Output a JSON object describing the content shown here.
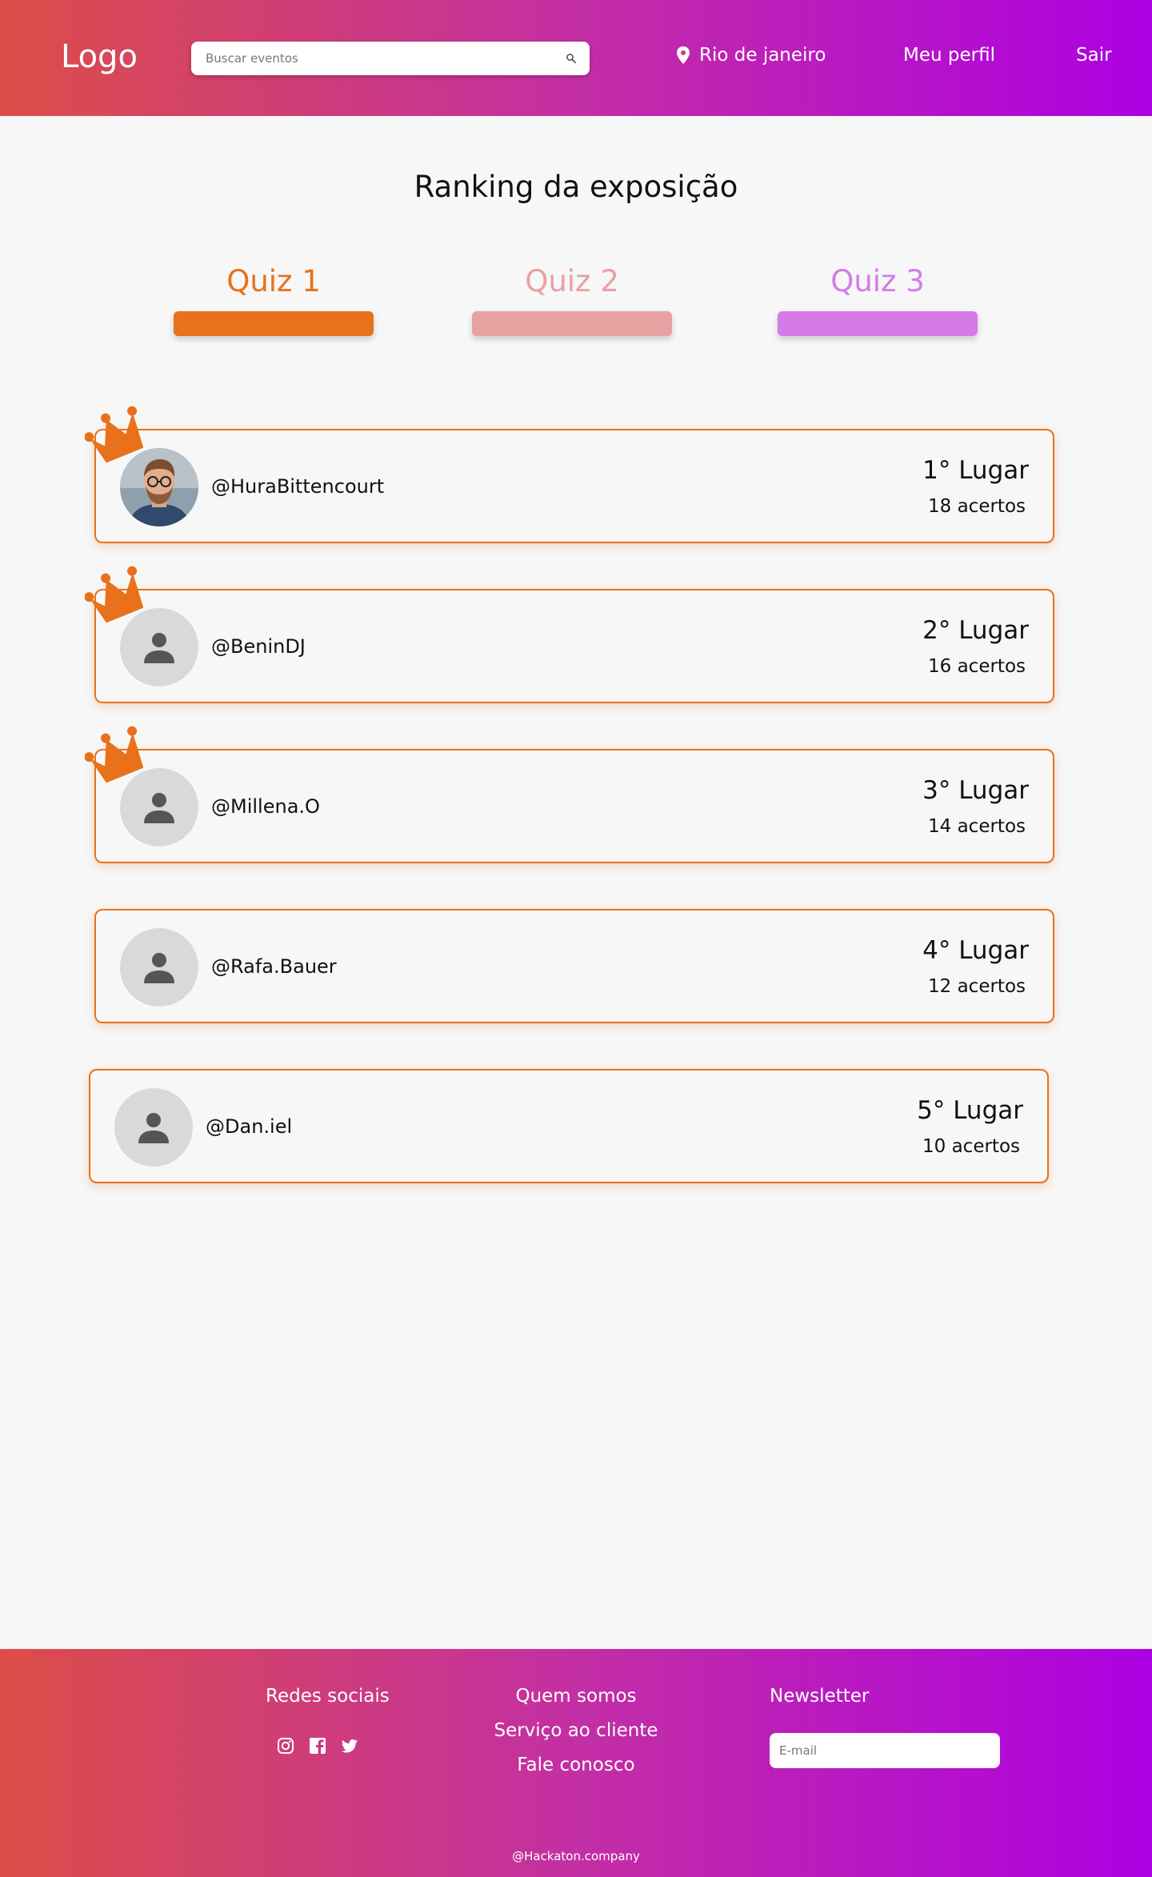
{
  "header": {
    "logo": "Logo",
    "search_placeholder": "Buscar eventos",
    "location": "Rio de janeiro",
    "profile": "Meu perfil",
    "logout": "Sair"
  },
  "page_title": "Ranking da exposição",
  "tabs": [
    {
      "label": "Quiz 1",
      "text_color": "#e9711a",
      "bar_color": "#e9711a",
      "active": true
    },
    {
      "label": "Quiz 2",
      "text_color": "#e8a1a1",
      "bar_color": "#e8a1a1",
      "active": false
    },
    {
      "label": "Quiz 3",
      "text_color": "#d47ae9",
      "bar_color": "#d47ae9",
      "active": false
    }
  ],
  "ranking": [
    {
      "username": "@HuraBittencourt",
      "place": "1° Lugar",
      "score": "18 acertos",
      "crown": true,
      "avatar": "photo"
    },
    {
      "username": "@BeninDJ",
      "place": "2° Lugar",
      "score": "16 acertos",
      "crown": true,
      "avatar": "placeholder"
    },
    {
      "username": "@Millena.O",
      "place": "3° Lugar",
      "score": "14 acertos",
      "crown": true,
      "avatar": "placeholder"
    },
    {
      "username": "@Rafa.Bauer",
      "place": "4° Lugar",
      "score": "12 acertos",
      "crown": false,
      "avatar": "placeholder"
    },
    {
      "username": "@Dan.iel",
      "place": "5° Lugar",
      "score": "10 acertos",
      "crown": false,
      "avatar": "placeholder"
    }
  ],
  "footer": {
    "social_heading": "Redes sociais",
    "social_icons": [
      "instagram-icon",
      "facebook-icon",
      "twitter-icon"
    ],
    "links": [
      "Quem somos",
      "Serviço ao cliente",
      "Fale conosco"
    ],
    "newsletter_heading": "Newsletter",
    "email_placeholder": "E-mail",
    "copyright": "@Hackaton.company"
  },
  "colors": {
    "accent": "#e9711a",
    "gradient_start": "#dc4d48",
    "gradient_end": "#ad00e2",
    "background": "#f7f7f7"
  }
}
